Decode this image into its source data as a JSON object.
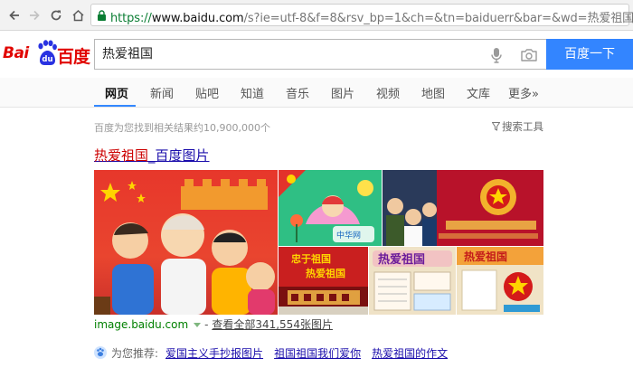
{
  "browser": {
    "url_secure": "https://",
    "url_host": "www.baidu.com",
    "url_path": "/s?ie=utf-8&f=8&rsv_bp=1&ch=&tn=baiduerr&bar=&wd=热爱祖国",
    "icons": [
      "back-arrow-icon",
      "forward-arrow-icon",
      "reload-icon",
      "home-icon",
      "lock-icon"
    ],
    "secure_color": "#0a7d33"
  },
  "header": {
    "logo_latin": "Bai",
    "logo_paw_text": "du",
    "logo_chinese": "百度",
    "search_value": "热爱祖国",
    "search_button": "百度一下",
    "brand_red": "#e10602",
    "button_blue": "#3385ff"
  },
  "tabs": [
    {
      "label": "网页",
      "active": true
    },
    {
      "label": "新闻",
      "active": false
    },
    {
      "label": "贴吧",
      "active": false
    },
    {
      "label": "知道",
      "active": false
    },
    {
      "label": "音乐",
      "active": false
    },
    {
      "label": "图片",
      "active": false
    },
    {
      "label": "视频",
      "active": false
    },
    {
      "label": "地图",
      "active": false
    },
    {
      "label": "文库",
      "active": false
    },
    {
      "label": "更多»",
      "active": false
    }
  ],
  "results": {
    "stats": "百度为您找到相关结果约10,900,000个",
    "tools": "搜索工具",
    "title_highlight": "热爱祖国",
    "title_rest": "_百度图片",
    "site_url": "image.baidu.com",
    "view_all_prefix": "- ",
    "view_all_link": "查看全部341,554张图片",
    "thumb_texts": {
      "t2_caption": "中华网",
      "t4_line1": "忠于祖国",
      "t4_line2": "热爱祖国",
      "t5_text": "热爱祖国",
      "t6_text": "热爱祖国"
    }
  },
  "recommend": {
    "label": "为您推荐:",
    "links": [
      "爱国主义手抄报图片",
      "祖国祖国我们爱你",
      "热爱祖国的作文"
    ]
  }
}
